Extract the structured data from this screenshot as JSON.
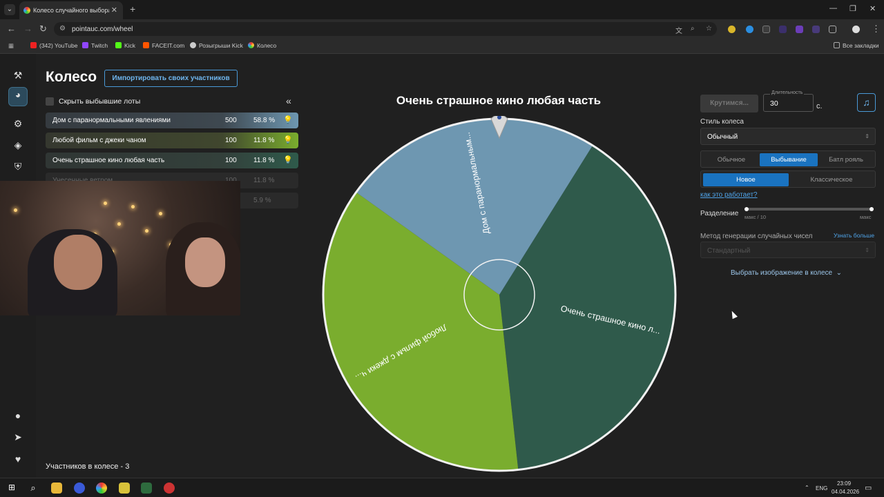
{
  "browser": {
    "tab_title": "Колесо случайного выбора – П",
    "url": "pointauc.com/wheel",
    "bookmarks": [
      "(342) YouTube",
      "Twitch",
      "Kick",
      "FACEIT.com",
      "Розыгрыши Kick",
      "Колесо"
    ],
    "all_bookmarks": "Все закладки"
  },
  "page": {
    "title": "Колесо",
    "import_button": "Импортировать своих участников",
    "hide_winners_label": "Скрыть выбывшие лоты",
    "participants_count": "Участников в колесе - 3"
  },
  "lots": [
    {
      "name": "Дом с паранормальными явлениями",
      "amount": "500",
      "percent": "58.8 %",
      "color": "#6e97b1"
    },
    {
      "name": "Любой фильм с джеки чаном",
      "amount": "100",
      "percent": "11.8 %",
      "color": "#7aad2e"
    },
    {
      "name": "Очень страшное кино любая часть",
      "amount": "100",
      "percent": "11.8 %",
      "color": "#2f5a4b"
    },
    {
      "name": "Унесенные ветром",
      "amount": "100",
      "percent": "11.8 %",
      "color": "#2a2a2a"
    },
    {
      "name": "",
      "amount": "",
      "percent": "5.9 %",
      "color": "#2a2a2a"
    }
  ],
  "wheel": {
    "winner_title": "Очень страшное кино любая часть",
    "segments": [
      {
        "label": "Очень страшное кино л...",
        "share": 0.394,
        "color": "#2f5a4b"
      },
      {
        "label": "Любой фильм с джеки ч...",
        "share": 0.366,
        "color": "#7aad2e"
      },
      {
        "label": "Дом с паранормальным...",
        "share": 0.24,
        "color": "#6e97b1"
      }
    ]
  },
  "controls": {
    "spin_button": "Крутимся...",
    "duration_label": "Длительность",
    "duration_value": "30",
    "duration_unit": "с.",
    "wheel_style_label": "Стиль колеса",
    "wheel_style_value": "Обычный",
    "modes": [
      "Обычное",
      "Выбывание",
      "Батл рояль"
    ],
    "active_mode": "Выбывание",
    "variants": [
      "Новое",
      "Классическое"
    ],
    "active_variant": "Новое",
    "how_link": "как это работает?",
    "split_label": "Разделение",
    "split_min": "макс / 10",
    "split_max": "макс",
    "rng_label": "Метод генерации случайных чисел",
    "rng_learn": "Узнать больше",
    "rng_value": "Стандартный",
    "image_picker": "Выбрать изображение в колесе"
  },
  "taskbar": {
    "lang": "ENG",
    "time": "23:09",
    "date": "04.04.2026"
  }
}
